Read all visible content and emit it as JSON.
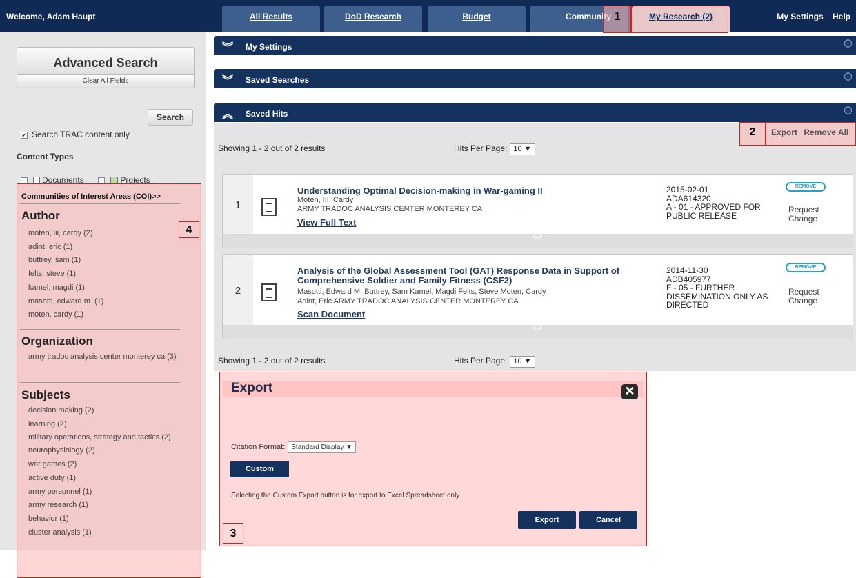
{
  "header": {
    "welcome": "Welcome, Adam Haupt",
    "tabs": [
      {
        "label": "All Results"
      },
      {
        "label": "DoD Research"
      },
      {
        "label": "Budget"
      },
      {
        "label": "Community"
      },
      {
        "label": "My Research (2)"
      }
    ],
    "my_settings": "My Settings",
    "help": "Help"
  },
  "callouts": {
    "c1": "1",
    "c2": "2",
    "c3": "3",
    "c4": "4"
  },
  "sidebar": {
    "advanced_search": "Advanced Search",
    "clear_all": "Clear All Fields",
    "search": "Search",
    "trac_only": "Search TRAC content only",
    "content_types": "Content Types",
    "documents": "Documents",
    "projects": "Projects",
    "coi": "Communities of Interest Areas (COI)>>",
    "author": {
      "title": "Author",
      "items": [
        "moten, iii, cardy (2)",
        "adint, eric (1)",
        "buttrey, sam (1)",
        "felts, steve (1)",
        "kamel, magdi (1)",
        "masotti, edward m. (1)",
        "moten, cardy (1)"
      ]
    },
    "organization": {
      "title": "Organization",
      "items": [
        "army tradoc analysis center monterey ca (3)"
      ]
    },
    "subjects": {
      "title": "Subjects",
      "items": [
        "decision making (2)",
        "learning (2)",
        "military operations, strategy and tactics (2)",
        "neurophysiology (2)",
        "war games (2)",
        "active duty (1)",
        "army personnel (1)",
        "army research (1)",
        "behavior (1)",
        "cluster analysis (1)"
      ]
    }
  },
  "panels": {
    "my_settings": "My Settings",
    "saved_searches": "Saved Searches",
    "saved_hits": "Saved Hits"
  },
  "hits": {
    "export": "Export",
    "remove_all": "Remove All",
    "showing": "Showing 1 - 2 out of 2 results",
    "per_page_label": "Hits Per Page:",
    "per_page_value": "10 ▼"
  },
  "results": [
    {
      "num": "1",
      "title": "Understanding Optimal Decision-making in War-gaming II",
      "authors": "Moten, III, Cardy",
      "org": "ARMY TRADOC ANALYSIS CENTER MONTEREY CA",
      "link": "View Full Text",
      "date": "2015-02-01",
      "accession": "ADA614320",
      "dist": "A - 01 - APPROVED FOR PUBLIC RELEASE",
      "remove": "REMOVE",
      "request": "Request Change"
    },
    {
      "num": "2",
      "title": "Analysis of the Global Assessment Tool (GAT) Response Data in Support of Comprehensive Soldier and Family Fitness (CSF2)",
      "authors": "Masotti, Edward M.  Buttrey, Sam  Kamel, Magdi  Felts, Steve  Moten, Cardy",
      "org": "Adint, Eric  ARMY TRADOC ANALYSIS CENTER MONTEREY CA",
      "link": "Scan Document",
      "date": "2014-11-30",
      "accession": "ADB405977",
      "dist": "F - 05 - FURTHER DISSEMINATION ONLY AS DIRECTED",
      "remove": "REMOVE",
      "request": "Request Change"
    }
  ],
  "dialog": {
    "title": "Export",
    "close": "✕",
    "citation_label": "Citation Format:",
    "citation_value": "Standard Display ▼",
    "custom": "Custom",
    "note": "Selecting the Custom Export button is for export to Excel Spreadsheet only.",
    "export": "Export",
    "cancel": "Cancel"
  }
}
